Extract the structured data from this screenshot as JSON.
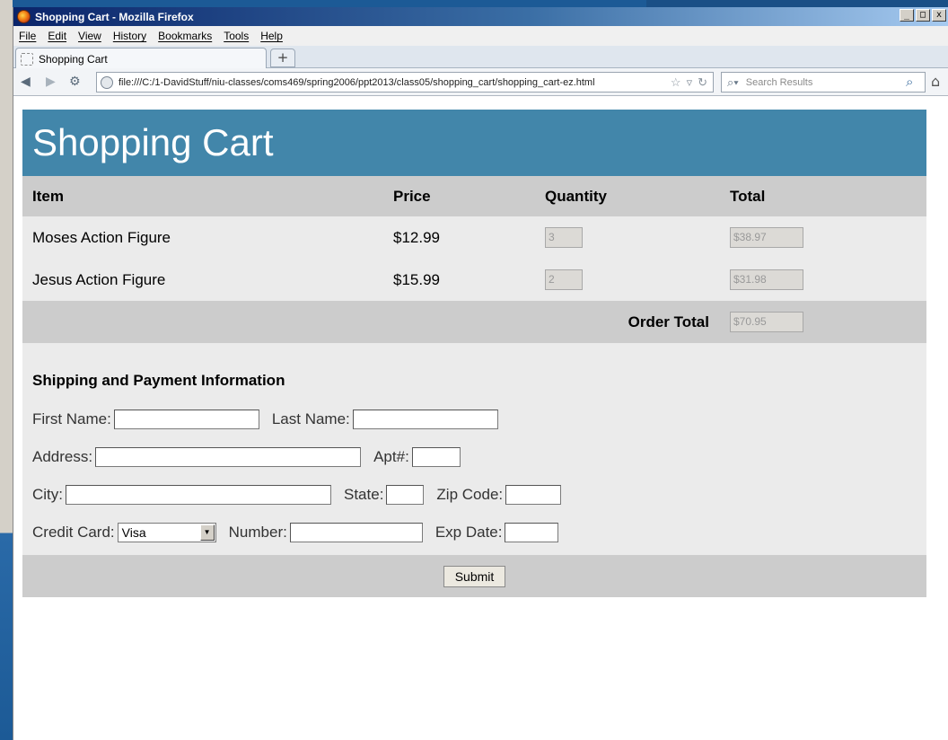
{
  "window": {
    "title": "Shopping Cart - Mozilla Firefox",
    "controls": [
      "_",
      "□",
      "x"
    ]
  },
  "menu": [
    "File",
    "Edit",
    "View",
    "History",
    "Bookmarks",
    "Tools",
    "Help"
  ],
  "tab": {
    "label": "Shopping Cart",
    "new_tab": "+"
  },
  "navbar": {
    "url": "file:///C:/1-DavidStuff/niu-classes/coms469/spring2006/ppt2013/class05/shopping_cart/shopping_cart-ez.html",
    "search_placeholder": "Search Results"
  },
  "page": {
    "heading": "Shopping Cart",
    "columns": {
      "item": "Item",
      "price": "Price",
      "quantity": "Quantity",
      "total": "Total"
    },
    "items": [
      {
        "name": "Moses Action Figure",
        "price": "$12.99",
        "quantity": "3",
        "total": "$38.97"
      },
      {
        "name": "Jesus Action Figure",
        "price": "$15.99",
        "quantity": "2",
        "total": "$31.98"
      }
    ],
    "order_total_label": "Order Total",
    "order_total": "$70.95",
    "shipping": {
      "title": "Shipping and Payment Information",
      "first_name_label": "First Name:",
      "last_name_label": "Last Name:",
      "address_label": "Address:",
      "apt_label": "Apt#:",
      "city_label": "City:",
      "state_label": "State:",
      "zip_label": "Zip Code:",
      "credit_card_label": "Credit Card:",
      "credit_card_value": "Visa",
      "number_label": "Number:",
      "exp_label": "Exp Date:"
    },
    "submit_label": "Submit"
  }
}
